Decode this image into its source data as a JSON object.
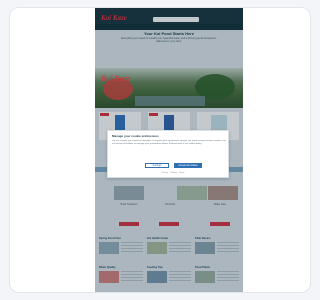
{
  "site": {
    "logo": "Koi Kaze",
    "hero_logo": "Koi Kaze"
  },
  "intro": {
    "title": "Your Koi Pond Starts Here",
    "text": "Everything you need for healthy koi, beautiful water and a thriving pond ecosystem, delivered to your door."
  },
  "products": [
    {
      "badge": "NEW"
    },
    {
      "badge": "NEW"
    },
    {
      "badge": ""
    }
  ],
  "featured": [
    {
      "caption": "Pond Treatment",
      "button": "Shop"
    },
    {
      "caption": "Koi Food",
      "button": "Shop"
    },
    {
      "caption": "Water Care",
      "button": "Shop"
    }
  ],
  "articles": [
    {
      "title": "Spring Pond Care"
    },
    {
      "title": "Koi Health Guide"
    },
    {
      "title": "Filter Basics"
    },
    {
      "title": "Water Quality"
    },
    {
      "title": "Feeding Tips"
    },
    {
      "title": "Pond Plants"
    }
  ],
  "cookie_modal": {
    "title": "Manage your cookie preferences",
    "text": "We use cookies and similar technologies to improve your experience, analyse site traffic and personalise content. You can accept all cookies or manage your preferences below. Find out more in our cookie policy.",
    "settings_label": "Settings",
    "accept_label": "Accept all cookies",
    "links": "Privacy  ·  Cookies  ·  Terms"
  }
}
